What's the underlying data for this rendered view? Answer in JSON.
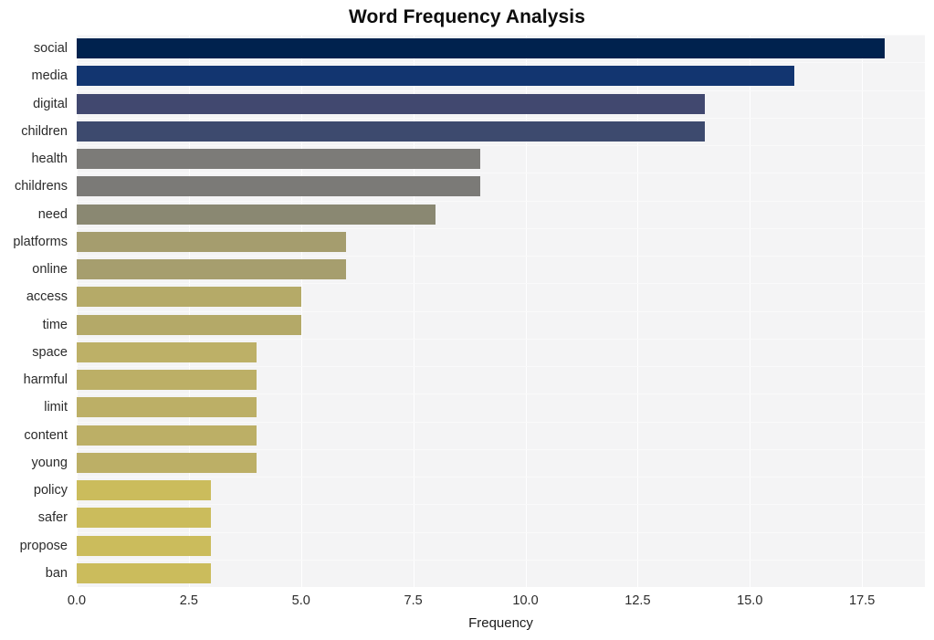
{
  "chart_data": {
    "type": "bar",
    "orientation": "horizontal",
    "title": "Word Frequency Analysis",
    "xlabel": "Frequency",
    "ylabel": "",
    "xlim": [
      0,
      18.9
    ],
    "ylim": [
      0,
      20
    ],
    "grid": true,
    "legend": "none",
    "xticks": [
      "0.0",
      "2.5",
      "5.0",
      "7.5",
      "10.0",
      "12.5",
      "15.0",
      "17.5"
    ],
    "xtick_values": [
      0,
      2.5,
      5,
      7.5,
      10,
      12.5,
      15,
      17.5
    ],
    "categories": [
      "social",
      "media",
      "digital",
      "children",
      "health",
      "childrens",
      "need",
      "platforms",
      "online",
      "access",
      "time",
      "space",
      "harmful",
      "limit",
      "content",
      "young",
      "policy",
      "safer",
      "propose",
      "ban"
    ],
    "values": [
      18,
      16,
      14,
      14,
      9,
      9,
      8,
      6,
      6,
      5,
      5,
      4,
      4,
      4,
      4,
      4,
      3,
      3,
      3,
      3
    ],
    "bar_colors": [
      "#00224e",
      "#123570",
      "#41486f",
      "#3d4a6e",
      "#7c7b78",
      "#7b7a77",
      "#8a8872",
      "#a59d6e",
      "#a69e6e",
      "#b5aa68",
      "#b4a968",
      "#bdb067",
      "#bcaf66",
      "#bcaf66",
      "#bcaf66",
      "#bcaf66",
      "#cbbc5c",
      "#cbbc5c",
      "#cbbc5c",
      "#cbbc5c"
    ],
    "background_color": "#f4f4f5",
    "figure_color": "#ffffff",
    "gridline_color": "#ffffff",
    "text_color": "#2b2b2b",
    "colormap": "cividis"
  }
}
